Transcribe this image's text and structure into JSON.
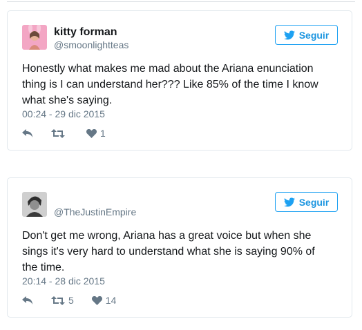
{
  "tweets": [
    {
      "user_name": "kitty forman",
      "handle": "@smoonlightteas",
      "follow_label": "Seguir",
      "text": "Honestly what makes me mad about the Ariana enunciation thing is I can understand her??? Like 85% of the time I know what she's saying.",
      "timestamp": "00:24 - 29 dic 2015",
      "retweets": "",
      "likes": "1"
    },
    {
      "user_name": "",
      "handle": "@TheJustinEmpire",
      "follow_label": "Seguir",
      "text": "Don't get me wrong, Ariana has a great voice but when she sings it's very hard to understand what she is saying 90% of the time.",
      "timestamp": "20:14 - 28 dic 2015",
      "retweets": "5",
      "likes": "14"
    }
  ],
  "colors": {
    "accent": "#1da1f2",
    "secondary_text": "#657786",
    "border": "#e1e8ed"
  },
  "icons": [
    "twitter-bird-icon",
    "reply-icon",
    "retweet-icon",
    "heart-icon"
  ]
}
